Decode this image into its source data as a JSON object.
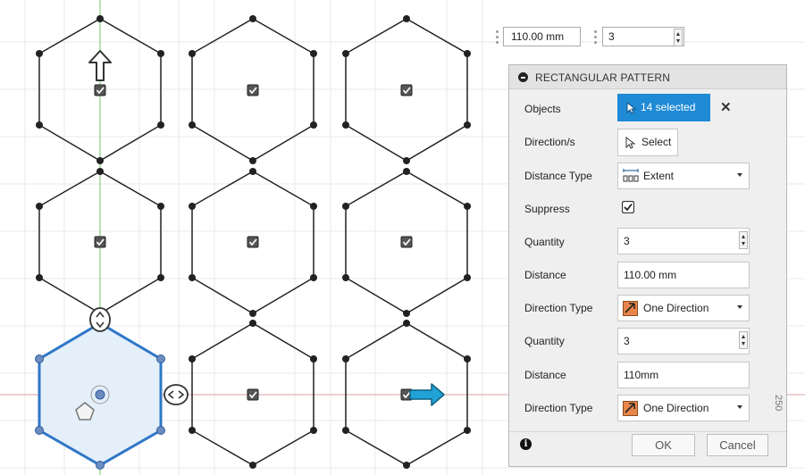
{
  "toolbar": {
    "distance_value": "110.00 mm",
    "quantity_value": "3"
  },
  "dialog": {
    "title": "RECTANGULAR PATTERN",
    "rows": {
      "objects": {
        "label": "Objects",
        "value": "14 selected"
      },
      "directions": {
        "label": "Direction/s",
        "value": "Select"
      },
      "distance_type": {
        "label": "Distance Type",
        "value": "Extent"
      },
      "suppress": {
        "label": "Suppress",
        "checked": true
      },
      "quantity1": {
        "label": "Quantity",
        "value": "3"
      },
      "distance1": {
        "label": "Distance",
        "value": "110.00 mm"
      },
      "direction_type1": {
        "label": "Direction Type",
        "value": "One Direction"
      },
      "quantity2": {
        "label": "Quantity",
        "value": "3"
      },
      "distance2": {
        "label": "Distance",
        "value": "110mm"
      },
      "direction_type2": {
        "label": "Direction Type",
        "value": "One Direction"
      }
    },
    "ok_label": "OK",
    "cancel_label": "Cancel"
  },
  "viewport": {
    "side_label": "250"
  },
  "colors": {
    "accent": "#1f8ad6",
    "selected_outline": "#2f77c8",
    "selected_fill": "#e4eff9",
    "y_axis": "#6dc46d",
    "x_axis": "#d8a0a0",
    "arrow": "#21a3d6"
  },
  "icons": {
    "close": "close-icon",
    "info": "info-icon",
    "cursor": "cursor-icon",
    "extent": "extent-icon",
    "direction": "one-direction-icon",
    "arrow_x": "arrow-right-icon",
    "arrow_y": "arrow-up-icon"
  }
}
